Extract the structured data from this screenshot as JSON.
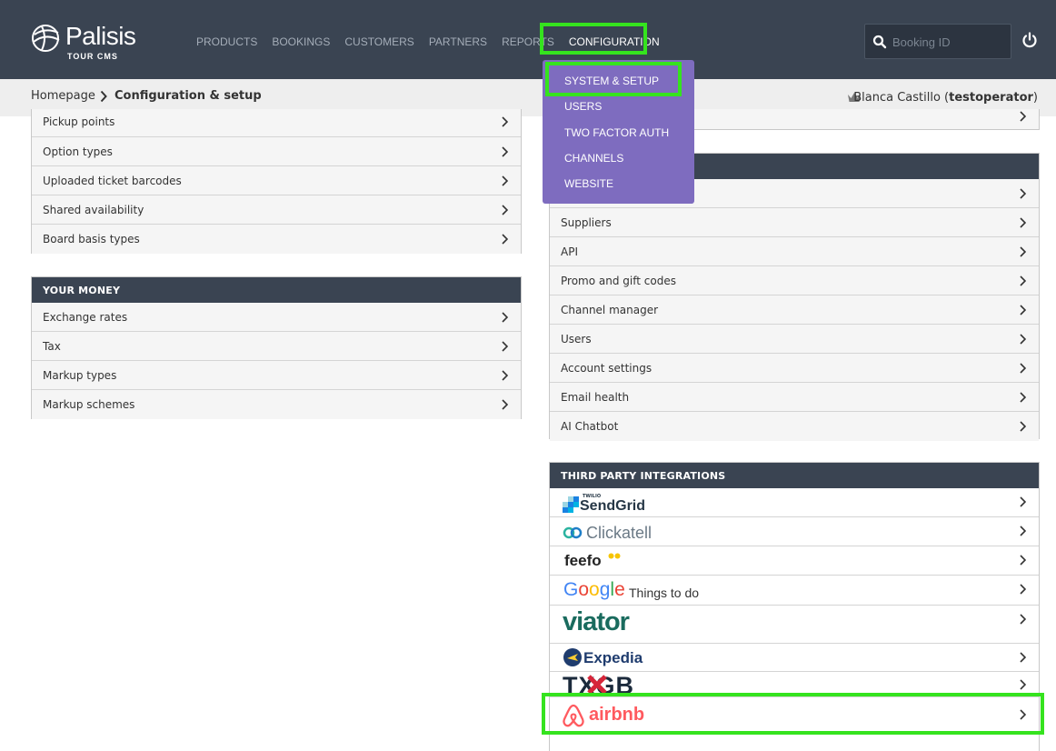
{
  "brand": {
    "name": "Palisis",
    "sub": "TOUR CMS"
  },
  "nav": [
    {
      "label": "PRODUCTS"
    },
    {
      "label": "BOOKINGS"
    },
    {
      "label": "CUSTOMERS"
    },
    {
      "label": "PARTNERS"
    },
    {
      "label": "REPORTS"
    },
    {
      "label": "CONFIGURATION"
    }
  ],
  "search": {
    "placeholder": "Booking ID"
  },
  "breadcrumb": {
    "home": "Homepage",
    "current": "Configuration & setup"
  },
  "user": {
    "name": "Blanca Castillo",
    "account": "testoperator"
  },
  "dropdown": [
    {
      "label": "SYSTEM & SETUP"
    },
    {
      "label": "USERS"
    },
    {
      "label": "TWO FACTOR AUTH"
    },
    {
      "label": "CHANNELS"
    },
    {
      "label": "WEBSITE"
    }
  ],
  "left_top": {
    "items": [
      "Pickup points",
      "Option types",
      "Uploaded ticket barcodes",
      "Shared availability",
      "Board basis types"
    ]
  },
  "your_money": {
    "title": "YOUR MONEY",
    "items": [
      "Exchange rates",
      "Tax",
      "Markup types",
      "Markup schemes"
    ]
  },
  "right_mid": {
    "items": [
      "Suppliers",
      "API",
      "Promo and gift codes",
      "Channel manager",
      "Users",
      "Account settings",
      "Email health",
      "AI Chatbot"
    ]
  },
  "integrations": {
    "title": "THIRD PARTY INTEGRATIONS",
    "logos": {
      "sendgrid_small": "TWILIO",
      "sendgrid": "SendGrid",
      "clickatell": "Clickatell",
      "feefo": "feefo",
      "google": "Google",
      "google_sub": "Things to do",
      "viator": "viator",
      "expedia": "Expedia",
      "txgb": "TXGB",
      "airbnb": "airbnb"
    }
  },
  "colors": {
    "nav_bg": "#3a4452",
    "dropdown_bg": "#7e6cbf",
    "highlight": "#35e31e",
    "airbnb": "#ff5a5f",
    "viator": "#1a6b5e",
    "expedia": "#1f3c6e"
  }
}
